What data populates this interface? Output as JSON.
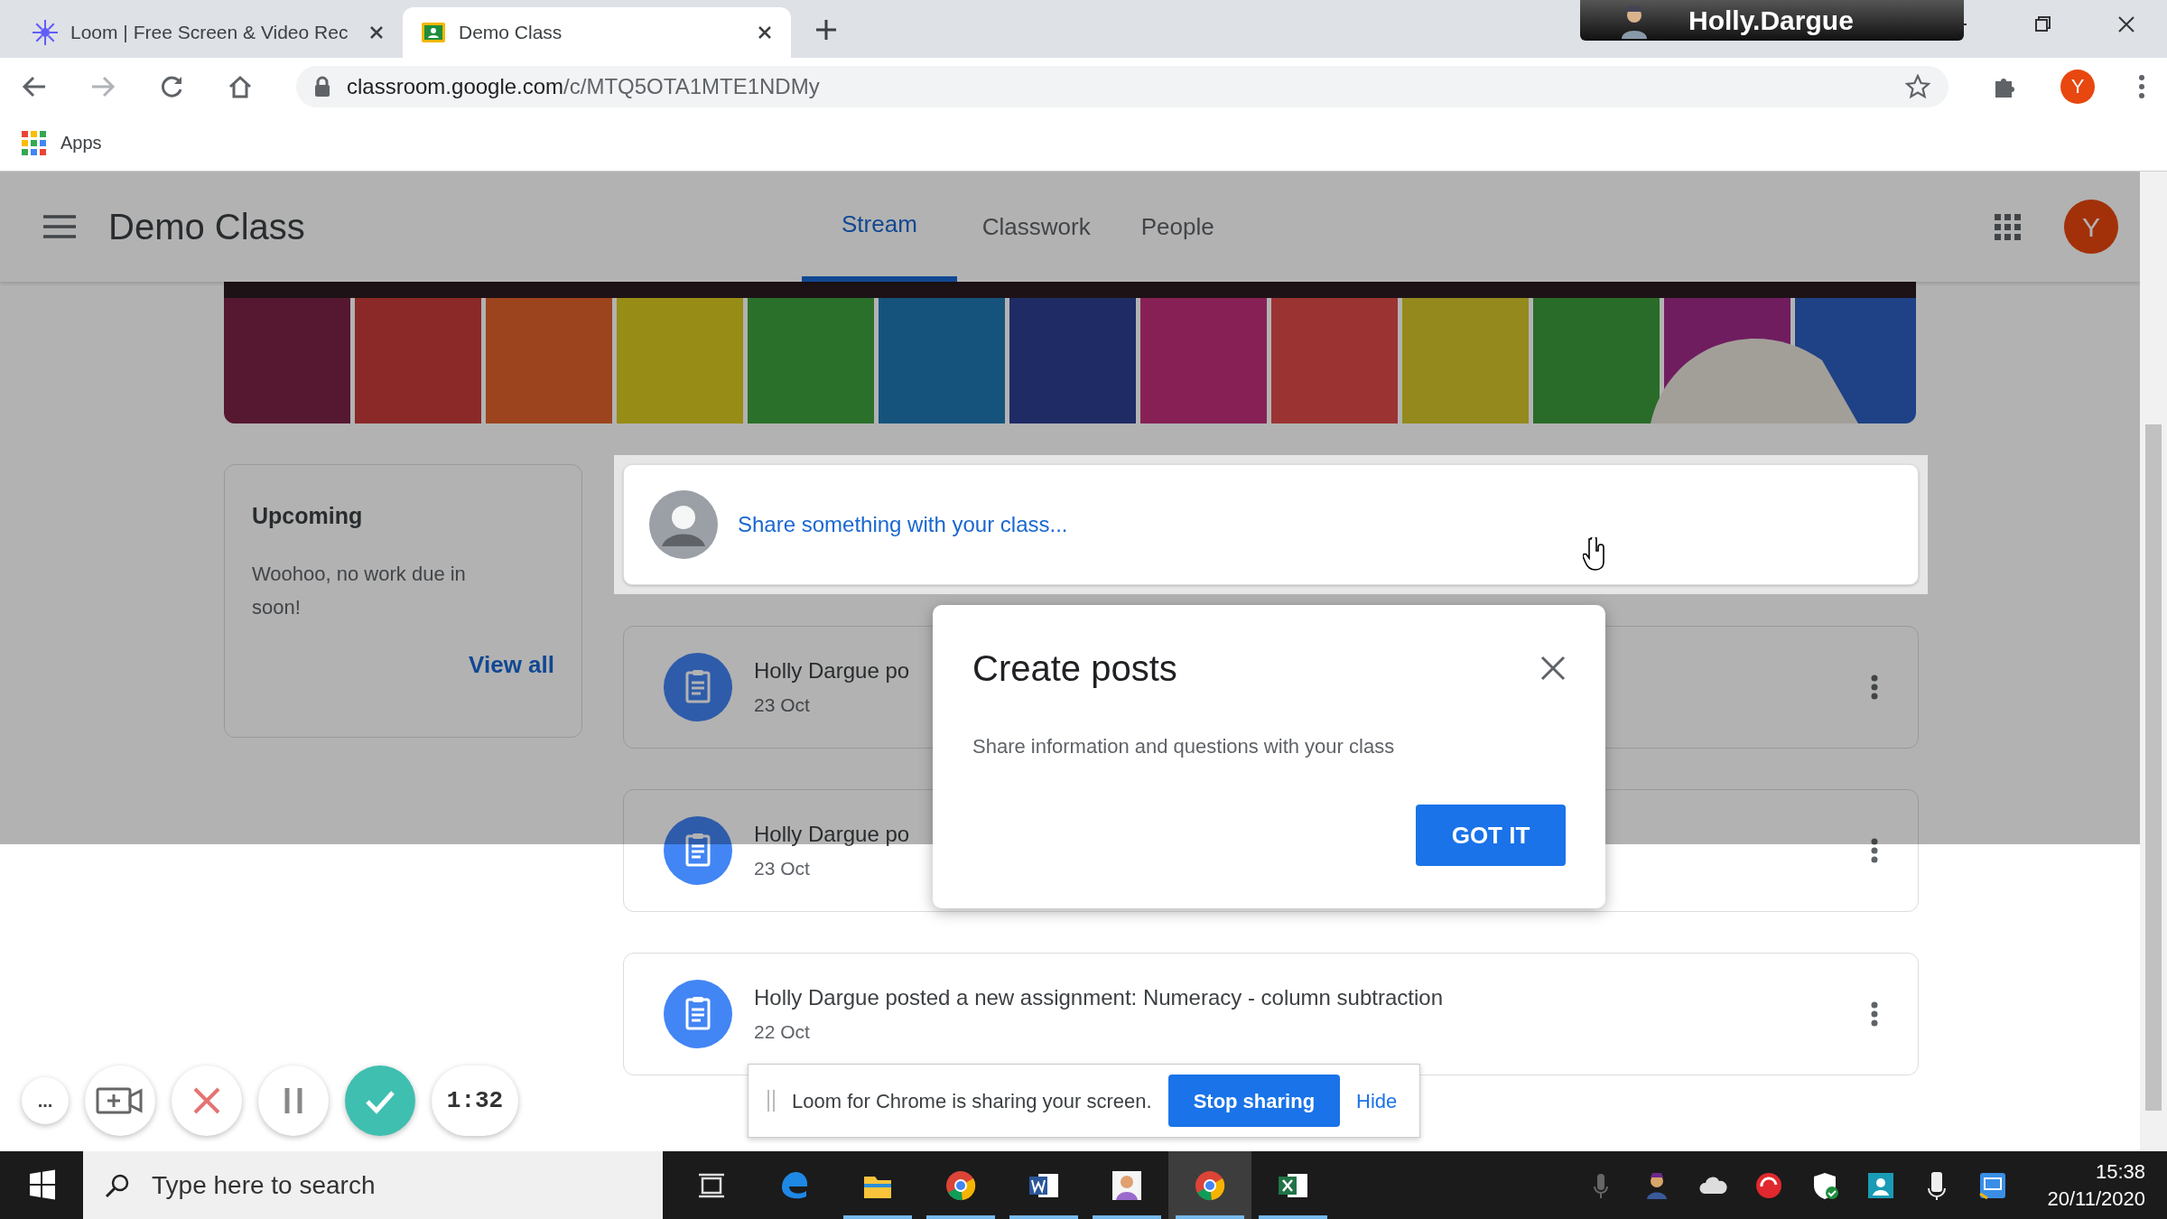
{
  "browser": {
    "tabs": [
      {
        "title": "Loom | Free Screen & Video Rec",
        "kind": "loom",
        "selected": false
      },
      {
        "title": "Demo Class",
        "kind": "classroom",
        "selected": true
      }
    ],
    "url_host": "classroom.google.com",
    "url_path": "/c/MTQ5OTA1MTE1NDMy",
    "profile_initial": "Y",
    "bookmarks": [
      "Apps"
    ]
  },
  "recording_badge": {
    "label": "Holly.Dargue"
  },
  "header": {
    "class_name": "Demo Class",
    "tabs": [
      {
        "label": "Stream",
        "selected": true
      },
      {
        "label": "Classwork",
        "selected": false
      },
      {
        "label": "People",
        "selected": false
      }
    ],
    "avatar_initial": "Y"
  },
  "upcoming": {
    "title": "Upcoming",
    "message": "Woohoo, no work due in soon!",
    "link": "View all"
  },
  "share_box": {
    "placeholder": "Share something with your class..."
  },
  "posts": [
    {
      "title": "Holly Dargue po",
      "date": "23 Oct"
    },
    {
      "title": "Holly Dargue po",
      "date": "23 Oct"
    },
    {
      "title": "Holly Dargue posted a new assignment: Numeracy - column subtraction",
      "date": "22 Oct"
    }
  ],
  "dialog": {
    "title": "Create posts",
    "body": "Share information and questions with your class",
    "button": "GOT IT"
  },
  "loom_controls": {
    "menu": "...",
    "timer": "1:32"
  },
  "sharing_bar": {
    "message": "Loom for Chrome is sharing your screen.",
    "stop": "Stop sharing",
    "hide": "Hide"
  },
  "taskbar": {
    "search_placeholder": "Type here to search",
    "apps": [
      {
        "kind": "taskview",
        "running": false,
        "selected": false
      },
      {
        "kind": "edge",
        "running": false,
        "selected": false
      },
      {
        "kind": "explorer",
        "running": true,
        "selected": false
      },
      {
        "kind": "chrome",
        "running": true,
        "selected": false
      },
      {
        "kind": "word",
        "running": true,
        "selected": false
      },
      {
        "kind": "contact",
        "running": true,
        "selected": false
      },
      {
        "kind": "chrome",
        "running": true,
        "selected": true
      },
      {
        "kind": "excel",
        "running": true,
        "selected": false
      }
    ],
    "time": "15:38",
    "date": "20/11/2020"
  }
}
